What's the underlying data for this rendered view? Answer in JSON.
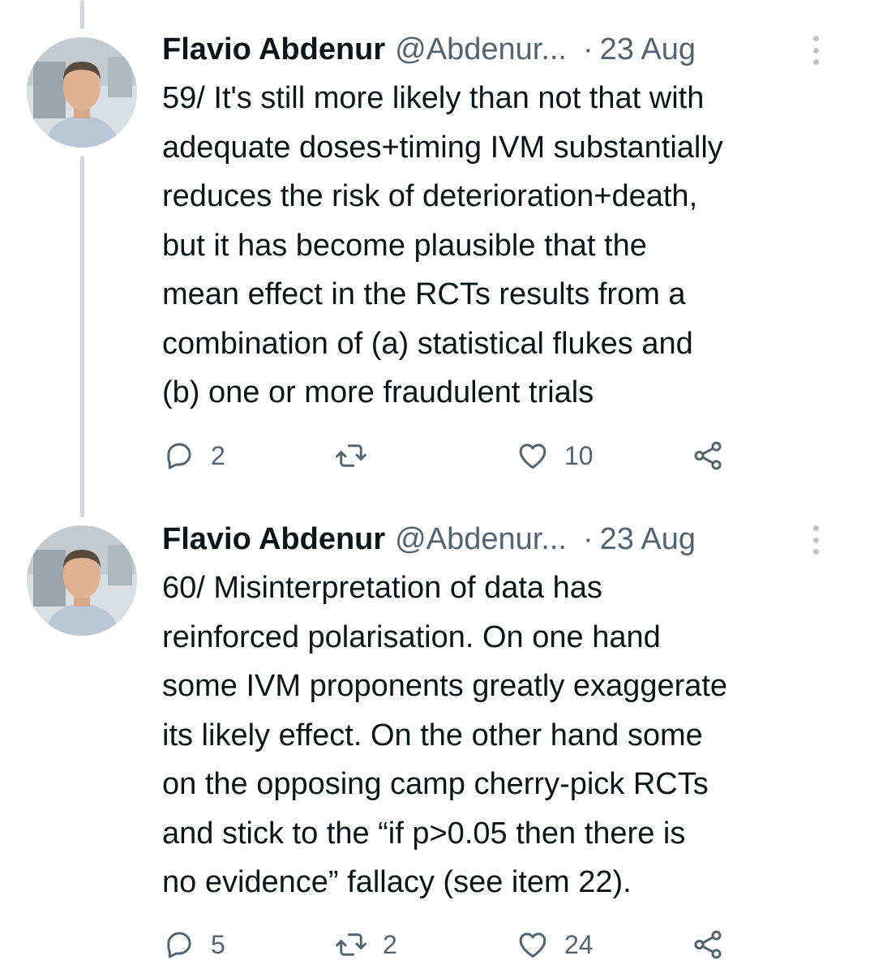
{
  "tweets": [
    {
      "author_name": "Flavio Abdenur",
      "handle": "@Abdenur...",
      "separator": "·",
      "date": "23 Aug",
      "text_lines": [
        "59/ It's still more likely than not that with",
        "adequate doses+timing IVM substantially",
        "reduces the risk of deterioration+death,",
        "but it has become plausible that the",
        "mean effect in the RCTs results from a",
        "combination of (a) statistical flukes and",
        "(b) one or more fraudulent trials"
      ],
      "replies": "2",
      "retweets": "",
      "likes": "10"
    },
    {
      "author_name": "Flavio Abdenur",
      "handle": "@Abdenur...",
      "separator": "·",
      "date": "23 Aug",
      "text_lines": [
        "60/ Misinterpretation of data has",
        "reinforced polarisation. On one hand",
        "some IVM proponents greatly exaggerate",
        "its likely effect. On the other hand some",
        "on the opposing camp cherry-pick RCTs",
        "and stick to the “if p>0.05 then there is",
        "no evidence” fallacy (see item 22)."
      ],
      "replies": "5",
      "retweets": "2",
      "likes": "24"
    }
  ],
  "icons": {
    "reply": "reply-icon",
    "retweet": "retweet-icon",
    "like": "heart-icon",
    "share": "share-icon",
    "more": "more-options-icon"
  },
  "colors": {
    "text_primary": "#0f1419",
    "text_secondary": "#536471",
    "thread_line": "#cfd9de"
  }
}
